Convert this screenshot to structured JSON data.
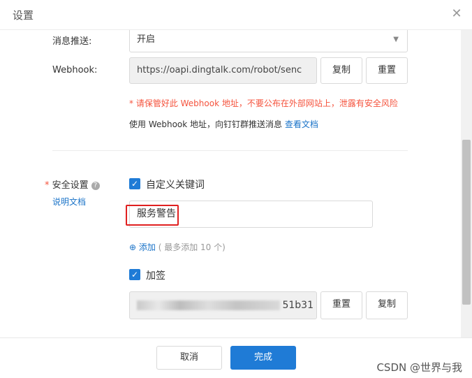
{
  "dialog": {
    "title": "设置"
  },
  "form": {
    "push_label": "消息推送:",
    "push_value": "开启",
    "webhook_label": "Webhook:",
    "webhook_value": "https://oapi.dingtalk.com/robot/senc",
    "copy_label": "复制",
    "reset_label": "重置",
    "warning": "* 请保管好此 Webhook 地址，不要公布在外部网站上，泄露有安全风险",
    "info_text": "使用 Webhook 地址，向钉钉群推送消息",
    "info_link": "查看文档",
    "security_label": "安全设置",
    "security_doc_link": "说明文档",
    "keyword_label": "自定义关键词",
    "keyword_value": "服务警告",
    "add_label": "添加",
    "add_hint": "( 最多添加 10 个)",
    "sign_label": "加签",
    "secret_value_tail": "51b31",
    "sign_reset_label": "重置",
    "sign_copy_label": "复制"
  },
  "footer": {
    "cancel_label": "取消",
    "ok_label": "完成"
  },
  "watermark": "CSDN @世界与我",
  "colors": {
    "primary": "#1f7bd6",
    "warning": "#f5533d",
    "highlight": "#e02020"
  }
}
